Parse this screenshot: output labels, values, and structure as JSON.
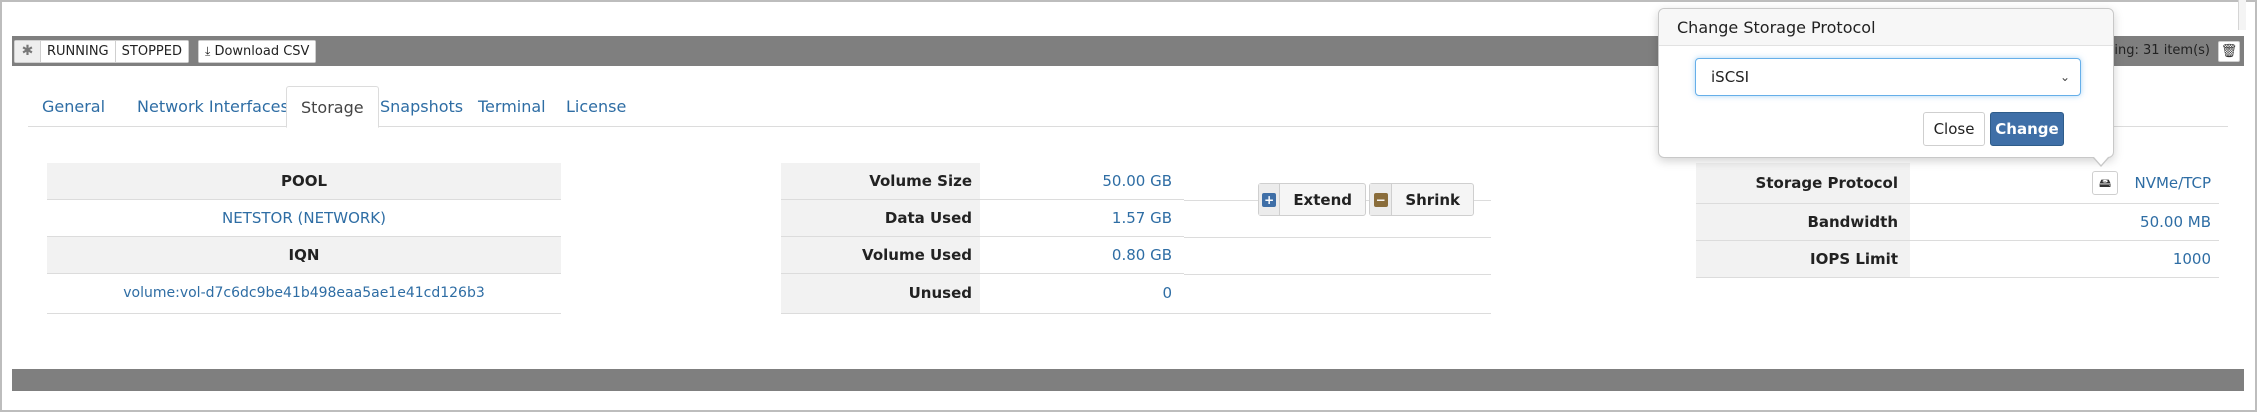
{
  "toolbar": {
    "gear_icon": "asterisk-icon",
    "running_label": "RUNNING",
    "stopped_label": "STOPPED",
    "download_label": "Download CSV",
    "showing_text": "Showing: 31 item(s)",
    "trash_icon": "trash-icon"
  },
  "tabs": [
    "General",
    "Network Interfaces",
    "Storage",
    "Snapshots",
    "Terminal",
    "License"
  ],
  "active_tab": "Storage",
  "pool": {
    "header": "POOL",
    "value": "NETSTOR (NETWORK)",
    "iqn_header": "IQN",
    "iqn_value": "volume:vol-d7c6dc9be41b498eaa5ae1e41cd126b3"
  },
  "volume": {
    "rows": [
      {
        "label": "Volume Size",
        "value": "50.00 GB"
      },
      {
        "label": "Data Used",
        "value": "1.57 GB"
      },
      {
        "label": "Volume Used",
        "value": "0.80 GB"
      },
      {
        "label": "Unused",
        "value": "0"
      }
    ],
    "extend_label": "Extend",
    "shrink_label": "Shrink"
  },
  "protocol": {
    "rows": [
      {
        "label": "Storage Protocol",
        "value": "NVMe/TCP"
      },
      {
        "label": "Bandwidth",
        "value": "50.00 MB"
      },
      {
        "label": "IOPS Limit",
        "value": "1000"
      }
    ]
  },
  "popover": {
    "title": "Change Storage Protocol",
    "selected": "iSCSI",
    "close_label": "Close",
    "change_label": "Change"
  },
  "colors": {
    "link": "#2e6da4",
    "primary_button": "#3f6fa7",
    "toolbar": "#7f7f7f",
    "extend_icon": "#3f6fa7",
    "shrink_icon": "#8a6d3b"
  }
}
